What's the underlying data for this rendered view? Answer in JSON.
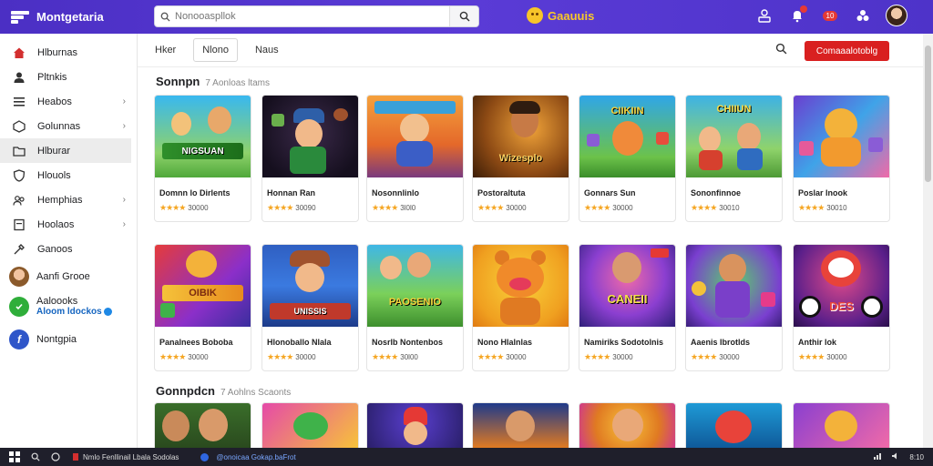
{
  "app": {
    "title": "Montgetaria",
    "center_brand": "Gaauuis"
  },
  "search": {
    "placeholder": "Nonooaspllok"
  },
  "topbar": {
    "badge_text": "10"
  },
  "sidebar": {
    "items": [
      {
        "label": "Hlburnas",
        "icon": "home-icon",
        "chevron": false
      },
      {
        "label": "Pltnkis",
        "icon": "person-icon",
        "chevron": false
      },
      {
        "label": "Heabos",
        "icon": "list-icon",
        "chevron": true
      },
      {
        "label": "Golunnas",
        "icon": "cube-icon",
        "chevron": true
      },
      {
        "label": "Hlburar",
        "icon": "folder-icon",
        "chevron": false
      },
      {
        "label": "Hlouols",
        "icon": "shield-icon",
        "chevron": false
      },
      {
        "label": "Hemphias",
        "icon": "people-icon",
        "chevron": true
      },
      {
        "label": "Hoolaos",
        "icon": "doc-icon",
        "chevron": true
      },
      {
        "label": "Ganoos",
        "icon": "tools-icon",
        "chevron": false
      }
    ],
    "accounts": [
      {
        "name": "Aanfi Grooe",
        "sub": ""
      },
      {
        "name": "Aaloooks",
        "sub": "Aloom ldockos"
      },
      {
        "name": "Nontgpia",
        "sub": ""
      }
    ]
  },
  "filters": {
    "chips": [
      "Hker",
      "Nlono",
      "Naus"
    ],
    "selected": "Nlono",
    "cta": "Comaaalotoblg"
  },
  "sections": [
    {
      "title": "Sonnpn",
      "subtitle": "7 Aonloas ltams"
    },
    {
      "title": "Gonnpdcn",
      "subtitle": "7 Aohlns Scaonts"
    }
  ],
  "cards_row1": [
    {
      "title": "Domnn lo Dirlents",
      "rating": "30000",
      "art": "NIGSUAN"
    },
    {
      "title": "Honnan Ran",
      "rating": "30090",
      "art": ""
    },
    {
      "title": "Nosonnlinlo",
      "rating": "3l0l0",
      "art": ""
    },
    {
      "title": "Postoraltuta",
      "rating": "30000",
      "art": "Wizesplo"
    },
    {
      "title": "Gonnars Sun",
      "rating": "30000",
      "art": "CIIKIIN"
    },
    {
      "title": "Sononfinnoe",
      "rating": "30010",
      "art": "CHIIUN"
    },
    {
      "title": "Poslar lnook",
      "rating": "30010",
      "art": ""
    }
  ],
  "cards_row2": [
    {
      "title": "Panalnees Boboba",
      "rating": "30000",
      "art": "OIBIK"
    },
    {
      "title": "Hlonoballo Nlala",
      "rating": "30000",
      "art": "UNISSIS"
    },
    {
      "title": "Nosrlb Nontenbos",
      "rating": "30l00",
      "art": "PAOSENIO"
    },
    {
      "title": "Nono Hlalnlas",
      "rating": "30000",
      "art": ""
    },
    {
      "title": "Namiriks Sodotolnis",
      "rating": "30000",
      "art": "CANEII"
    },
    {
      "title": "Aaenis Ibrotlds",
      "rating": "30000",
      "art": ""
    },
    {
      "title": "Anthir lok",
      "rating": "30000",
      "art": "DES"
    }
  ],
  "taskbar": {
    "item1": "Nmlo Fenllinail Lbala Sodolas",
    "item2": "@onoicaa Gokap.baFrot",
    "time": "8:10"
  }
}
